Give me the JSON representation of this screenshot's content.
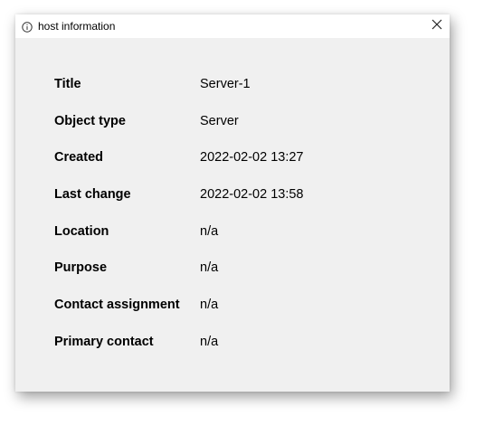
{
  "window": {
    "title": "host information",
    "icons": {
      "title_icon": "info-icon",
      "close": "close-icon"
    }
  },
  "fields": [
    {
      "label": "Title",
      "value": "Server-1"
    },
    {
      "label": "Object type",
      "value": "Server"
    },
    {
      "label": "Created",
      "value": "2022-02-02 13:27"
    },
    {
      "label": "Last change",
      "value": "2022-02-02 13:58"
    },
    {
      "label": "Location",
      "value": "n/a"
    },
    {
      "label": "Purpose",
      "value": "n/a"
    },
    {
      "label": "Contact assignment",
      "value": "n/a"
    },
    {
      "label": "Primary contact",
      "value": "n/a"
    }
  ]
}
